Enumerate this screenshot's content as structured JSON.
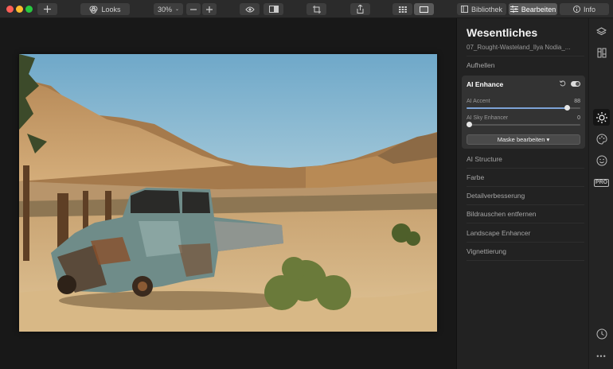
{
  "toolbar": {
    "looks_label": "Looks",
    "zoom": "30%",
    "tabs": {
      "bibliothek": "Bibliothek",
      "bearbeiten": "Bearbeiten",
      "info": "Info"
    }
  },
  "panel": {
    "title": "Wesentliches",
    "filename": "07_Rought-Wasteland_Ilya Nodia_...",
    "aufhellen": "Aufhellen",
    "ai_enhance": {
      "title": "AI Enhance",
      "accent_label": "AI Accent",
      "accent_value": "88",
      "sky_label": "AI Sky Enhancer",
      "sky_value": "0",
      "mask_button": "Maske bearbeiten ▾"
    },
    "sections": [
      "AI Structure",
      "Farbe",
      "Detailverbesserung",
      "Bildrauschen entfernen",
      "Landscape Enhancer",
      "Vignettierung"
    ]
  },
  "strip": {
    "pro_label": "PRO",
    "more_label": "•••"
  },
  "colors": {
    "accent": "#7da3d6",
    "panel_bg": "#222222",
    "card_bg": "#333333"
  }
}
